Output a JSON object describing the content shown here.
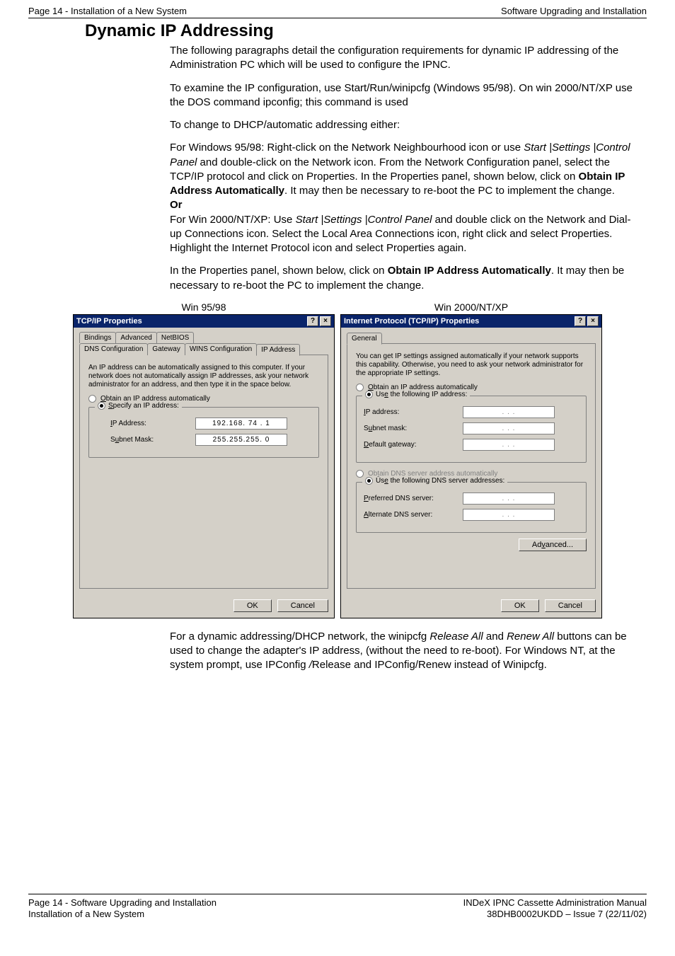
{
  "header": {
    "left": "Page 14 - Installation of a New System",
    "right": "Software Upgrading and Installation"
  },
  "title": "Dynamic IP Addressing",
  "paragraphs": {
    "p1": "The following paragraphs detail the configuration requirements for dynamic IP addressing of the Administration PC which will be used to configure the IPNC.",
    "p2": "To examine the IP configuration, use Start/Run/winipcfg (Windows 95/98). On win 2000/NT/XP use the DOS command ipconfig; this command is used",
    "p3": "To change to DHCP/automatic addressing either:",
    "p4a": "For Windows 95/98: Right-click on the Network Neighbourhood icon or use ",
    "p4b_italic": "Start |Settings |Control Panel",
    "p4c": " and double-click on the Network icon. From the Network Configuration panel, select the TCP/IP protocol and click on Properties. In the Properties panel, shown below, click on ",
    "p4d_bold": "Obtain IP Address Automatically",
    "p4e": ". It may then be necessary to re-boot the PC to implement the change.",
    "or": "Or",
    "p5a": "For Win 2000/NT/XP: Use ",
    "p5b_italic": "Start |Settings |Control Panel",
    "p5c": " and double click on the Network and Dial-up Connections icon. Select the Local Area Connections icon, right click and select Properties. Highlight the Internet Protocol icon and select Properties again.",
    "p6a": "In the Properties panel, shown below, click on ",
    "p6b_bold": "Obtain IP Address Automatically",
    "p6c": ". It may then be necessary to re-boot the PC to implement the change.",
    "p7a": "For a dynamic addressing/DHCP network, the winipcfg ",
    "p7b_italic": "Release All",
    "p7c": " and ",
    "p7d_italic": "Renew All",
    "p7e": " buttons can be used to change the adapter's IP address, (without the need to re-boot). For Windows NT, at the system prompt, use IPConfig ",
    "p7f_italic": "/",
    "p7g": "Release and IPConfig/Renew instead of Winipcfg."
  },
  "captions": {
    "left": "Win 95/98",
    "right": "Win 2000/NT/XP"
  },
  "win95": {
    "title": "TCP/IP Properties",
    "help": "?",
    "close": "×",
    "tabs_back": [
      "Bindings",
      "Advanced",
      "NetBIOS"
    ],
    "tabs_front": [
      "DNS Configuration",
      "Gateway",
      "WINS Configuration",
      "IP Address"
    ],
    "desc": "An IP address can be automatically assigned to this computer. If your network does not automatically assign IP addresses, ask your network administrator for an address, and then type it in the space below.",
    "r1_pre": "O",
    "r1_post": "btain an IP address automatically",
    "r2_pre": "S",
    "r2_post": "pecify an IP address:",
    "ip_lbl_pre": "I",
    "ip_lbl_post": "P Address:",
    "ip_val": "192.168. 74 .  1",
    "sm_lbl_pre": "S",
    "sm_lbl_mid": "u",
    "sm_lbl_post": "bnet Mask:",
    "sm_val": "255.255.255.  0",
    "ok": "OK",
    "cancel": "Cancel"
  },
  "win2k": {
    "title": "Internet Protocol (TCP/IP) Properties",
    "help": "?",
    "close": "×",
    "tab": "General",
    "desc": "You can get IP settings assigned automatically if your network supports this capability. Otherwise, you need to ask your network administrator for the appropriate IP settings.",
    "r1_pre": "O",
    "r1_post": "btain an IP address automatically",
    "r2_pre": "Us",
    "r2_mid": "e",
    "r2_post": " the following IP address:",
    "ip_lbl_pre": "I",
    "ip_lbl_post": "P address:",
    "sm_lbl_pre": "S",
    "sm_lbl_mid": "u",
    "sm_lbl_post": "bnet mask:",
    "gw_lbl_pre": "D",
    "gw_lbl_post": "efault gateway:",
    "r3_pre": "Ob",
    "r3_mid": "t",
    "r3_post": "ain DNS server address automatically",
    "r4_pre": "Us",
    "r4_mid": "e",
    "r4_post": " the following DNS server addresses:",
    "pdns_pre": "P",
    "pdns_post": "referred DNS server:",
    "adns_pre": "A",
    "adns_post": "lternate DNS server:",
    "adv_pre": "Ad",
    "adv_mid": "v",
    "adv_post": "anced...",
    "ok": "OK",
    "cancel": "Cancel",
    "dots": ".       .       ."
  },
  "footer": {
    "l1": "Page 14 - Software Upgrading and Installation",
    "l2": "Installation of a New System",
    "r1": "INDeX IPNC Cassette Administration Manual",
    "r2": "38DHB0002UKDD – Issue 7 (22/11/02)"
  }
}
